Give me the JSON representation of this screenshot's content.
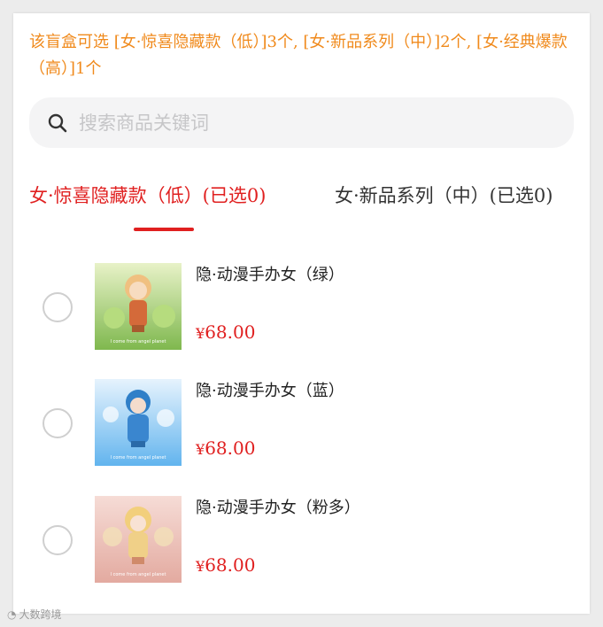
{
  "notice": "该盲盒可选 [女·惊喜隐藏款（低）]3个, [女·新品系列（中）]2个, [女·经典爆款（高）]1个",
  "search": {
    "placeholder": "搜索商品关键词",
    "icon": "search-icon"
  },
  "tabs": [
    {
      "label": "女·惊喜隐藏款（低）(已选0)",
      "active": true
    },
    {
      "label": "女·新品系列（中）(已选0)",
      "active": false
    }
  ],
  "products": [
    {
      "name": "隐·动漫手办女（绿）",
      "currency": "¥",
      "price": "68.00",
      "selected": false,
      "thumb_caption": "I come from angel planet",
      "color": "#8ec25e"
    },
    {
      "name": "隐·动漫手办女（蓝）",
      "currency": "¥",
      "price": "68.00",
      "selected": false,
      "thumb_caption": "I come from angel planet",
      "color": "#5aaee8"
    },
    {
      "name": "隐·动漫手办女（粉多）",
      "currency": "¥",
      "price": "68.00",
      "selected": false,
      "thumb_caption": "I come from angel planet",
      "color": "#e8b0a8"
    }
  ],
  "watermark": "大数跨境",
  "colors": {
    "accent": "#e02020",
    "notice": "#f08a1c"
  }
}
